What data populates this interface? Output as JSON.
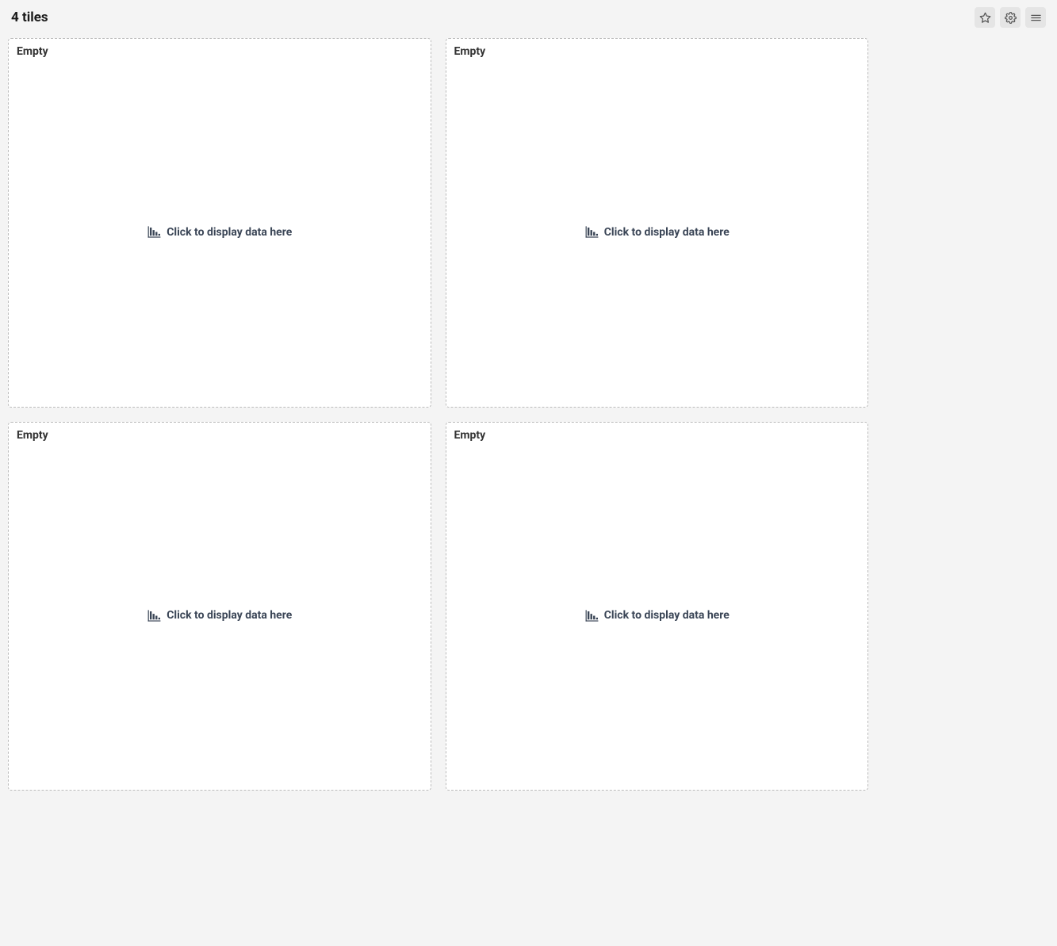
{
  "header": {
    "title": "4 tiles"
  },
  "tiles": [
    {
      "label": "Empty",
      "placeholder": "Click to display data here"
    },
    {
      "label": "Empty",
      "placeholder": "Click to display data here"
    },
    {
      "label": "Empty",
      "placeholder": "Click to display data here"
    },
    {
      "label": "Empty",
      "placeholder": "Click to display data here"
    }
  ]
}
